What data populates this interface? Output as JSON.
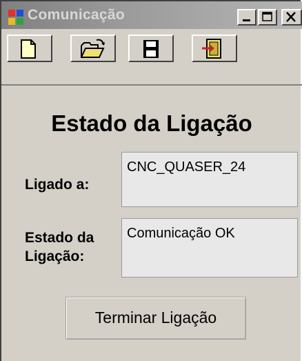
{
  "window": {
    "title": "Comunicação",
    "controls": {
      "minimize_icon": "minimize-icon",
      "maximize_icon": "maximize-icon",
      "close_icon": "close-icon"
    }
  },
  "toolbar": {
    "buttons": [
      {
        "icon": "new-document-icon"
      },
      {
        "icon": "open-folder-icon"
      },
      {
        "icon": "save-disk-icon"
      },
      {
        "icon": "exit-door-icon"
      }
    ]
  },
  "main": {
    "heading": "Estado da Ligação",
    "connected_label": "Ligado a:",
    "connected_value": "CNC_QUASER_24",
    "status_label_line1": "Estado da",
    "status_label_line2": "Ligação:",
    "status_value": "Comunicação OK",
    "terminate_button": "Terminar Ligação"
  }
}
